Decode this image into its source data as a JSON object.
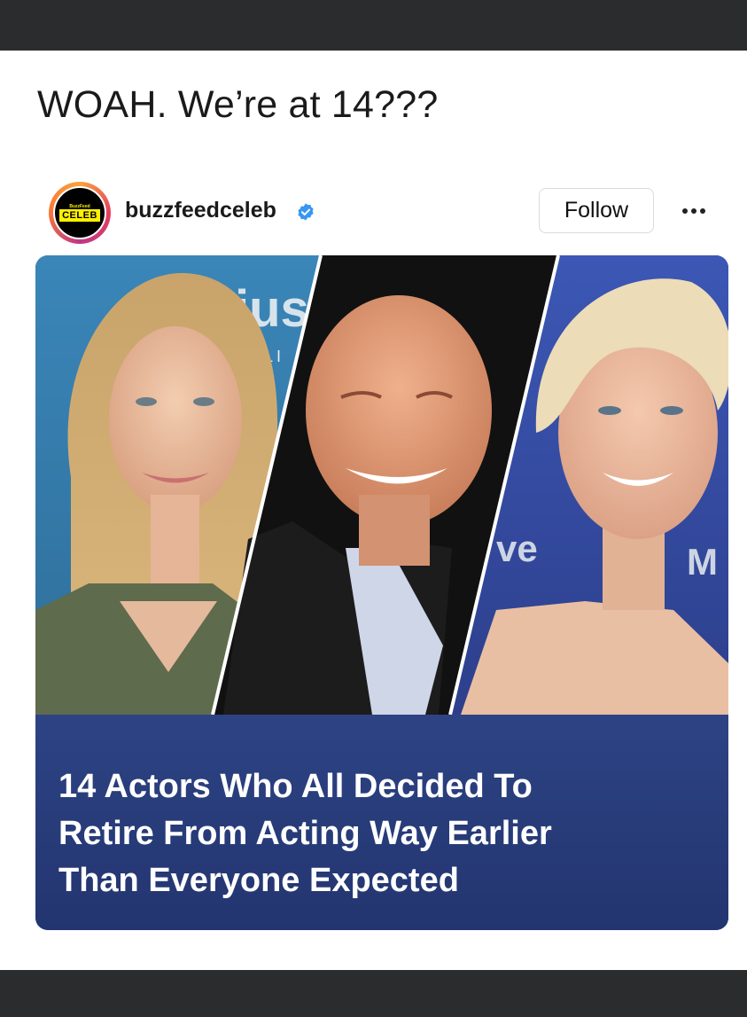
{
  "caption": "WOAH. We’re at 14???",
  "post": {
    "username": "buzzfeedceleb",
    "avatar_text": "CELEB",
    "avatar_small_text": "BuzzFeed",
    "verified_icon": "verified-badge-icon",
    "follow_label": "Follow",
    "more_icon": "more-options-icon"
  },
  "card": {
    "headline_lines": [
      "14 Actors Who All Decided To",
      "Retire From Acting Way Earlier",
      "Than Everyone Expected"
    ],
    "photo_backdrop_text": [
      "ius",
      "LI",
      "ve",
      "M"
    ]
  },
  "colors": {
    "bars": "#2b2c2e",
    "headline_panel": "#2d4384",
    "verified": "#3897f0"
  }
}
